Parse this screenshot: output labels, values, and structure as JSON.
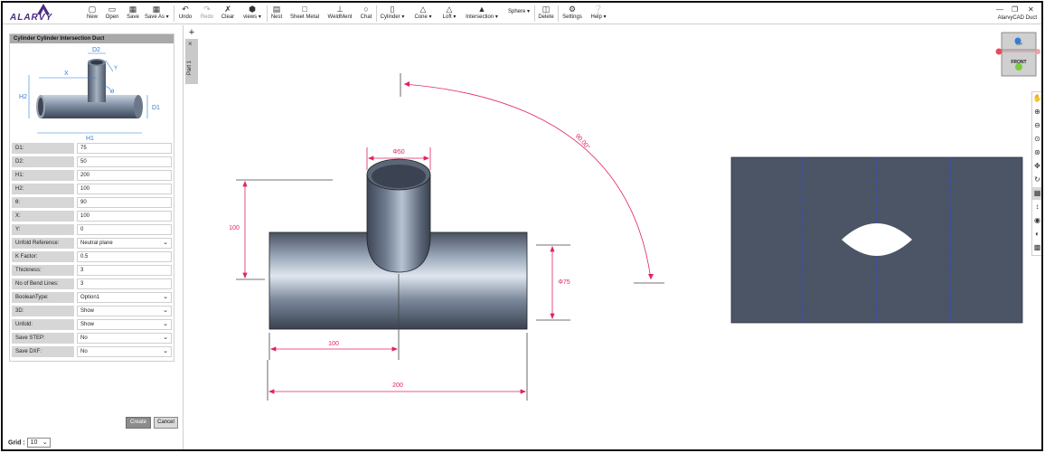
{
  "app": {
    "title": "AlarvyCAD Duct",
    "logo_text": "ALARVY"
  },
  "toolbar": {
    "items": [
      {
        "label": "New",
        "icon": "file-icon"
      },
      {
        "label": "Open",
        "icon": "folder-icon"
      },
      {
        "label": "Save",
        "icon": "floppy-icon"
      },
      {
        "label": "Save As ▾",
        "icon": "save-as-icon"
      },
      {
        "label": "Undo",
        "icon": "undo-icon"
      },
      {
        "label": "Redo",
        "icon": "redo-icon"
      },
      {
        "label": "Clear",
        "icon": "eraser-icon"
      },
      {
        "label": "views ▾",
        "icon": "cube-icon"
      },
      {
        "label": "Nest",
        "icon": "nest-icon"
      },
      {
        "label": "Sheet Metal",
        "icon": "sheet-icon"
      },
      {
        "label": "WeldMent",
        "icon": "weldment-icon"
      },
      {
        "label": "Chat",
        "icon": "chat-icon"
      },
      {
        "label": "Cylinder ▾",
        "icon": "cylinder-icon"
      },
      {
        "label": "Cone ▾",
        "icon": "cone-icon"
      },
      {
        "label": "Loft ▾",
        "icon": "loft-icon"
      },
      {
        "label": "Intersection ▾",
        "icon": "intersection-icon"
      },
      {
        "label": "Sphere ▾",
        "icon": ""
      },
      {
        "label": "Delete",
        "icon": "trash-icon"
      },
      {
        "label": "Settings",
        "icon": "gear-icon"
      },
      {
        "label": "Help ▾",
        "icon": "help-icon"
      }
    ]
  },
  "panel": {
    "title": "Cylinder Cylinder Intersection Duct",
    "sketch_labels": {
      "D2": "D2",
      "X": "X",
      "Y": "Y",
      "theta": "θ",
      "H2": "H2",
      "D1": "D1",
      "H1": "H1"
    },
    "fields": [
      {
        "label": "D1:",
        "value": "75",
        "type": "input"
      },
      {
        "label": "D2:",
        "value": "50",
        "type": "input"
      },
      {
        "label": "H1:",
        "value": "200",
        "type": "input"
      },
      {
        "label": "H2:",
        "value": "100",
        "type": "input"
      },
      {
        "label": "θ:",
        "value": "90",
        "type": "input"
      },
      {
        "label": "X:",
        "value": "100",
        "type": "input"
      },
      {
        "label": "Y:",
        "value": "0",
        "type": "input"
      },
      {
        "label": "Unfold Reference:",
        "value": "Neutral plane",
        "type": "select"
      },
      {
        "label": "K Factor:",
        "value": "0.5",
        "type": "input"
      },
      {
        "label": "Thickness:",
        "value": "3",
        "type": "input"
      },
      {
        "label": "No of Bend Lines:",
        "value": "3",
        "type": "input"
      },
      {
        "label": "BooleanType:",
        "value": "Option1",
        "type": "select"
      },
      {
        "label": "3D:",
        "value": "Show",
        "type": "select"
      },
      {
        "label": "Unfold:",
        "value": "Show",
        "type": "select"
      },
      {
        "label": "Save STEP:",
        "value": "No",
        "type": "select"
      },
      {
        "label": "Save DXF:",
        "value": "No",
        "type": "select"
      }
    ],
    "create_label": "Create",
    "cancel_label": "Cancel"
  },
  "grid": {
    "label": "Grid :",
    "value": "10"
  },
  "tabs": {
    "add_label": "+",
    "close_label": "×",
    "part_name": "Part 1"
  },
  "viewport": {
    "dims": {
      "top_dia": "Φ50",
      "side_dia": "Φ75",
      "height": "100",
      "offset": "100",
      "length": "200",
      "angle": "90.00°"
    }
  },
  "viewcube": {
    "top": "TOP",
    "front": "FRONT"
  },
  "side_tools": [
    "hand-icon",
    "zoom-in-icon",
    "zoom-out-icon",
    "zoom-fit-icon",
    "zoom-window-icon",
    "pan-icon",
    "rotate-icon",
    "grid-toggle-icon",
    "measure-icon",
    "eye-icon",
    "contrast-icon",
    "layers-icon"
  ],
  "colors": {
    "accent": "#e0245e",
    "model": "#4b5566",
    "hidden_line": "#3344ee"
  }
}
